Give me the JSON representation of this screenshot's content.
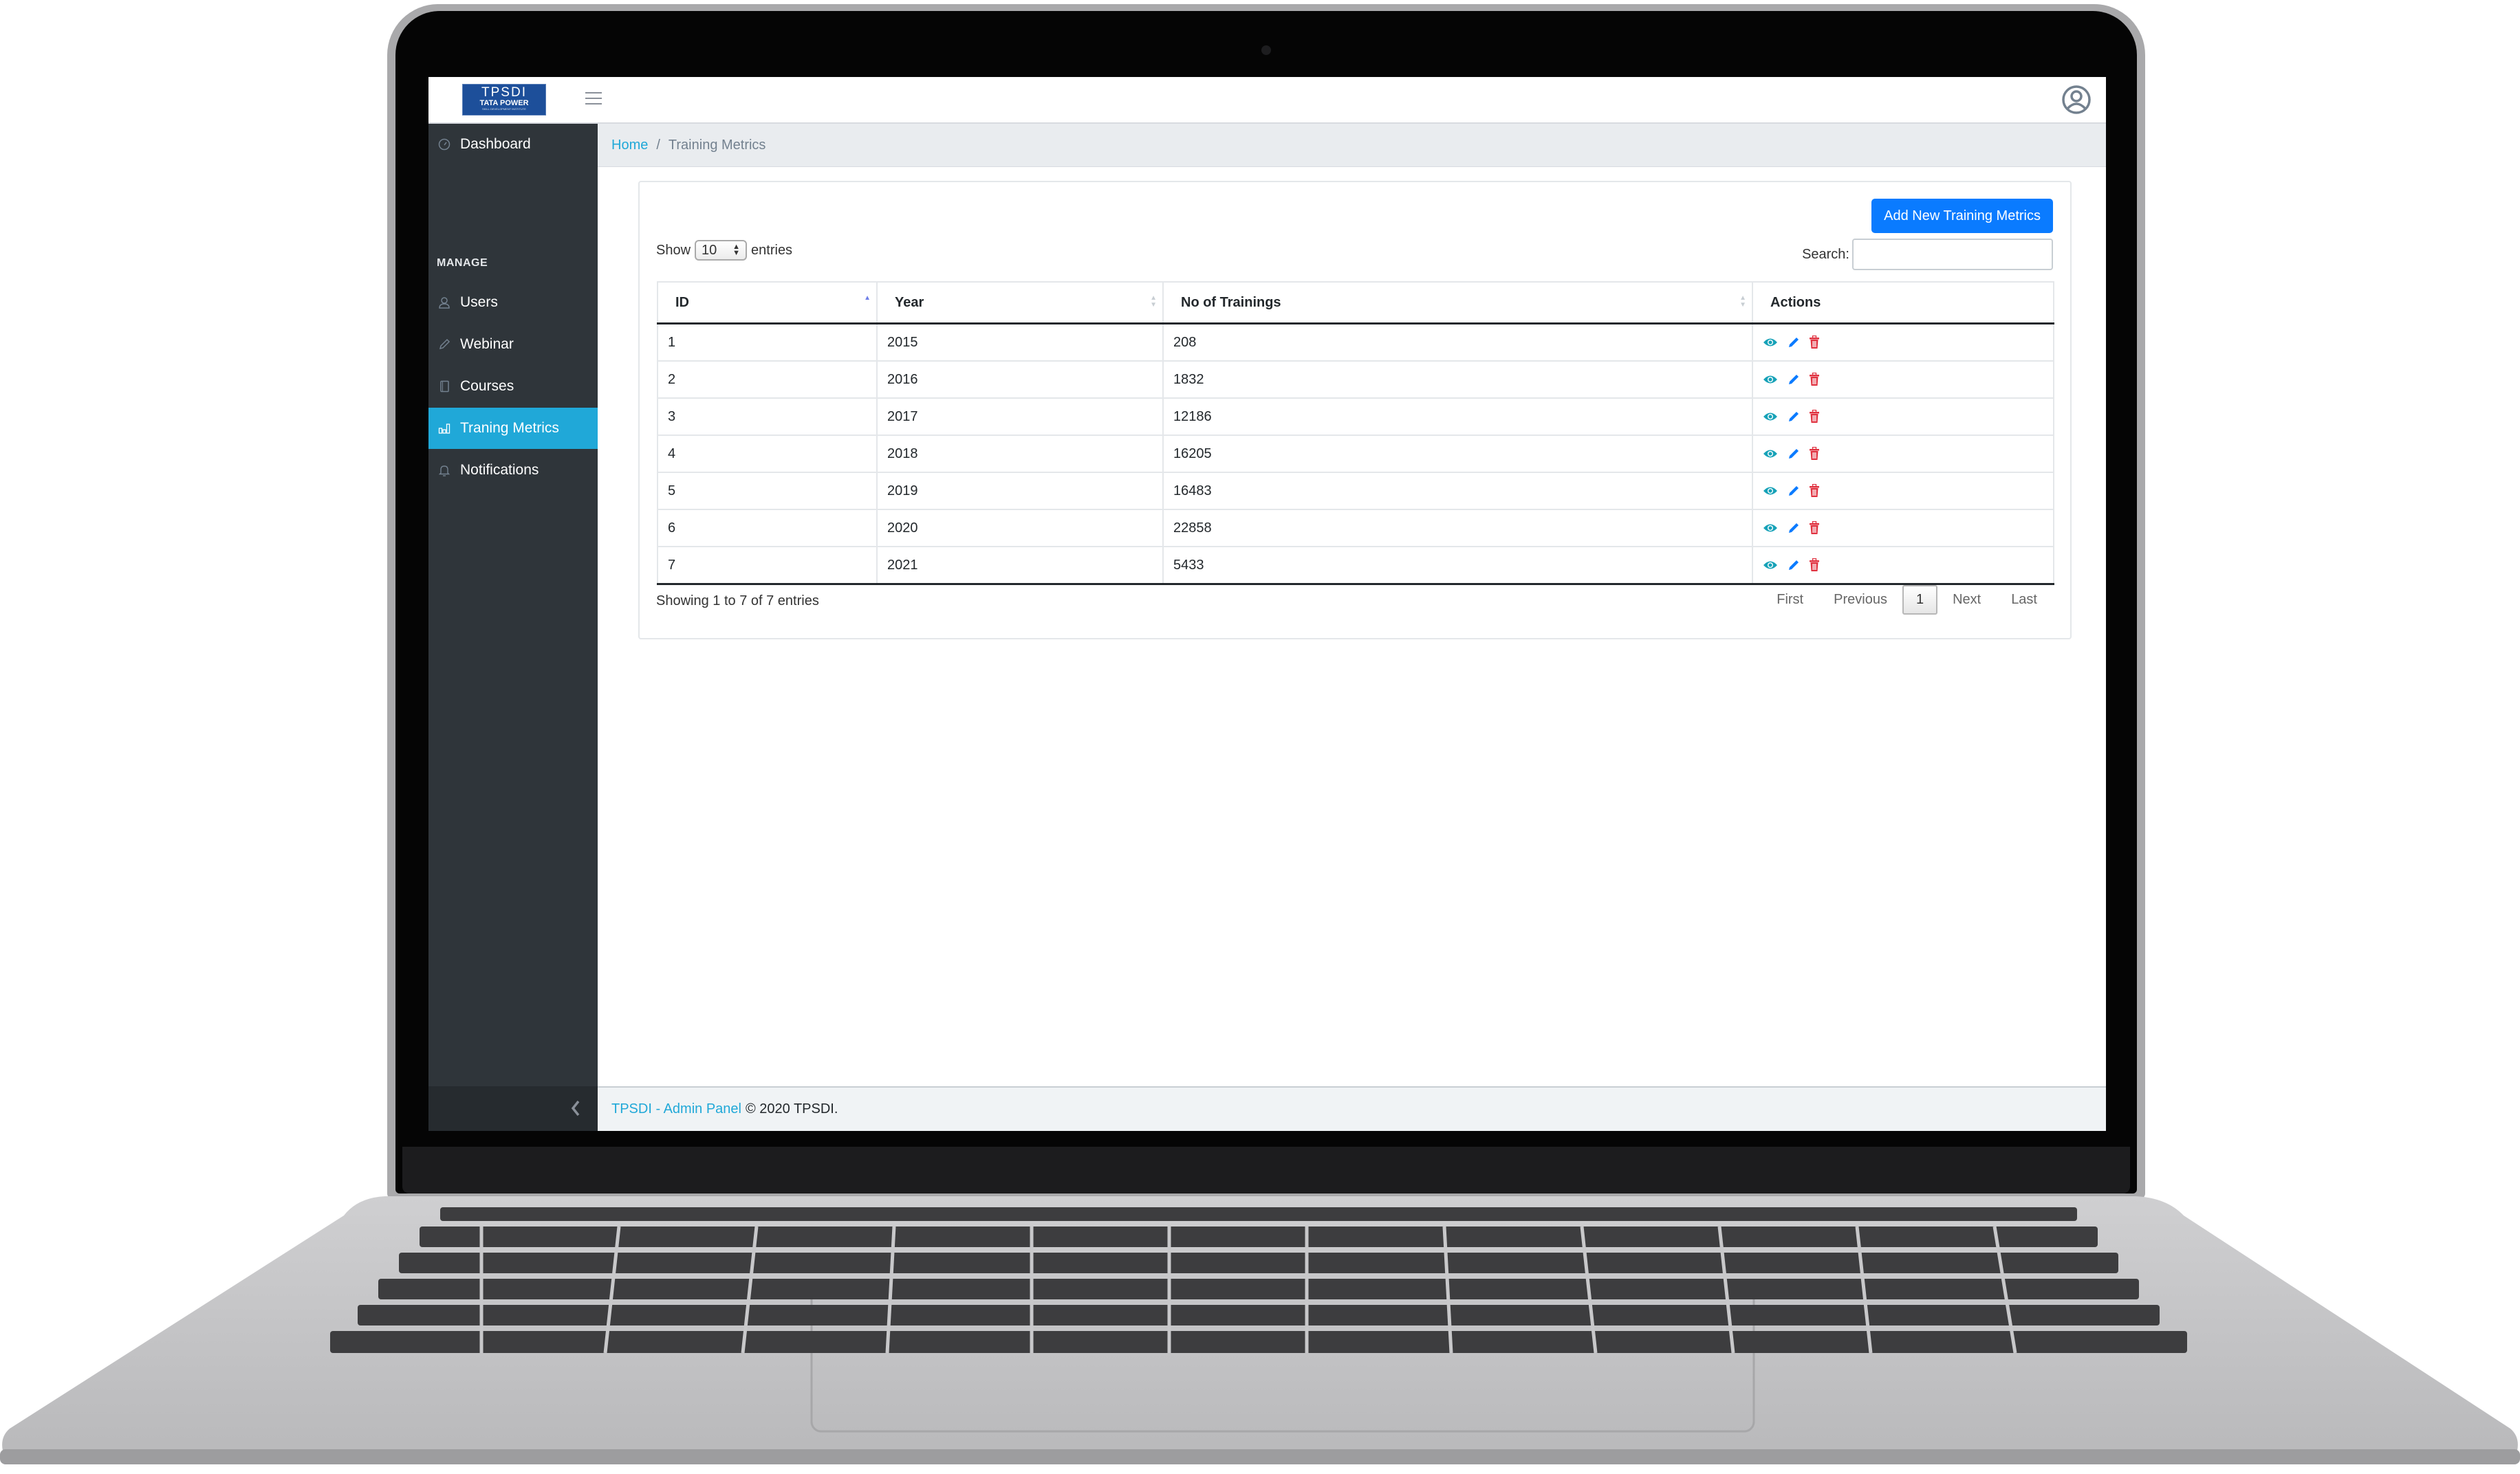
{
  "header": {
    "logo": {
      "line1": "TPSDI",
      "line2": "TATA POWER",
      "line3": "SKILL DEVELOPMENT INSTITUTE"
    },
    "menu_icon": "hamburger-icon",
    "user_icon": "user-circle-icon"
  },
  "sidebar": {
    "dashboard": {
      "label": "Dashboard",
      "icon": "speedometer-icon"
    },
    "section_title": "MANAGE",
    "items": [
      {
        "label": "Users",
        "icon": "user-icon"
      },
      {
        "label": "Webinar",
        "icon": "pencil-icon"
      },
      {
        "label": "Courses",
        "icon": "notebook-icon"
      },
      {
        "label": "Traning Metrics",
        "icon": "bar-chart-icon",
        "active": true
      },
      {
        "label": "Notifications",
        "icon": "bell-icon"
      }
    ],
    "collapse_icon": "chevron-left-icon"
  },
  "breadcrumb": {
    "home": "Home",
    "separator": "/",
    "current": "Training Metrics"
  },
  "card": {
    "add_button": "Add New Training Metrics",
    "show_label": "Show",
    "page_length": "10",
    "entries_label": "entries",
    "search_label": "Search:",
    "search_value": "",
    "columns": [
      "ID",
      "Year",
      "No of Trainings",
      "Actions"
    ],
    "sorted_column": "ID",
    "sort_direction": "asc",
    "rows": [
      {
        "id": "1",
        "year": "2015",
        "trainings": "208"
      },
      {
        "id": "2",
        "year": "2016",
        "trainings": "1832"
      },
      {
        "id": "3",
        "year": "2017",
        "trainings": "12186"
      },
      {
        "id": "4",
        "year": "2018",
        "trainings": "16205"
      },
      {
        "id": "5",
        "year": "2019",
        "trainings": "16483"
      },
      {
        "id": "6",
        "year": "2020",
        "trainings": "22858"
      },
      {
        "id": "7",
        "year": "2021",
        "trainings": "5433"
      }
    ],
    "row_actions": [
      "view",
      "edit",
      "delete"
    ],
    "info": "Showing 1 to 7 of 7 entries",
    "pagination": {
      "first": "First",
      "previous": "Previous",
      "current_page": "1",
      "next": "Next",
      "last": "Last"
    }
  },
  "footer": {
    "brand": "TPSDI - Admin Panel",
    "copyright": "© 2020 TPSDI."
  },
  "colors": {
    "primary": "#0a7bff",
    "sidebar_bg": "#2f353a",
    "sidebar_active": "#20a8d8",
    "view_icon": "#17a2b8",
    "edit_icon": "#0a7bff",
    "delete_icon": "#e0313f",
    "link": "#20a8d8"
  }
}
